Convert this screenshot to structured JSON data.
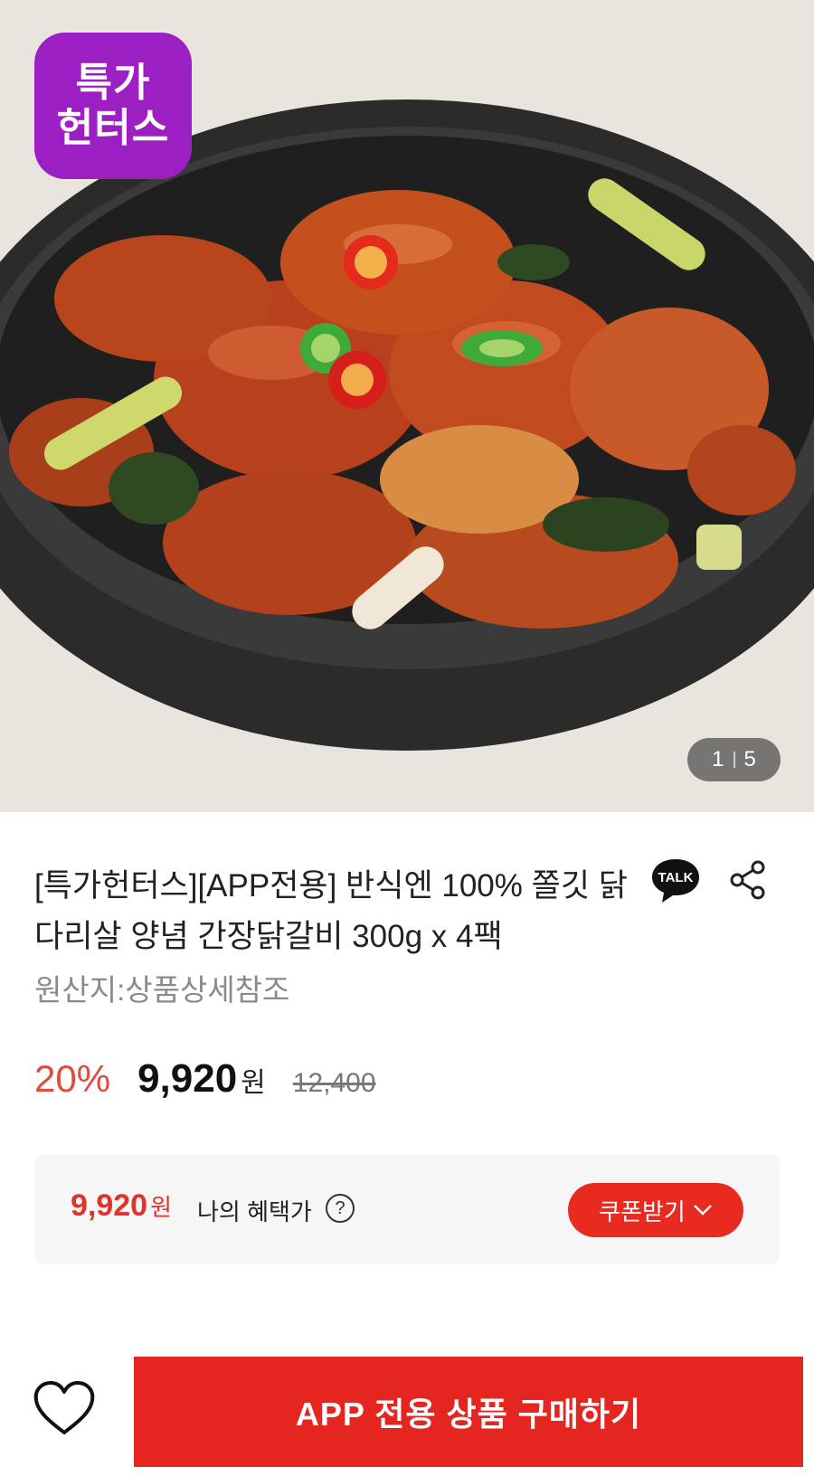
{
  "hero": {
    "badge_line1": "특가",
    "badge_line2": "헌터스",
    "counter_current": "1",
    "counter_total": "5"
  },
  "product": {
    "title": "[특가헌터스][APP전용] 반식엔 100% 쫄깃 닭다리살 양념 간장닭갈비 300g x 4팩",
    "origin": "원산지:상품상세참조"
  },
  "icons": {
    "talk": "talk-icon",
    "talk_label": "TALK",
    "share": "share-icon",
    "help": "help-icon",
    "chevron": "chevron-down-icon",
    "heart": "heart-icon"
  },
  "price": {
    "discount": "20%",
    "sale_price": "9,920",
    "currency": "원",
    "original_price": "12,400"
  },
  "benefit": {
    "price": "9,920",
    "currency": "원",
    "label": "나의 혜택가",
    "help": "?",
    "coupon_button": "쿠폰받기"
  },
  "bottom": {
    "buy_button": "APP 전용 상품 구매하기"
  },
  "colors": {
    "accent": "#e52620",
    "discount": "#e24a3b",
    "badge": "#9c1fc4"
  }
}
